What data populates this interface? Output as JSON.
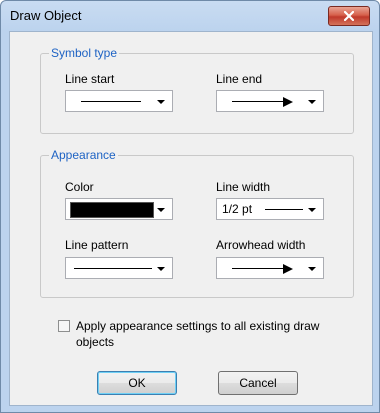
{
  "window": {
    "title": "Draw Object",
    "close_icon": "close-x-icon"
  },
  "symbol_type": {
    "legend": "Symbol type",
    "line_start_label": "Line start",
    "line_end_label": "Line end",
    "line_start_value": "plain line",
    "line_end_value": "line with arrowhead"
  },
  "appearance": {
    "legend": "Appearance",
    "color_label": "Color",
    "color_value": "#000000",
    "line_width_label": "Line width",
    "line_width_value": "1/2 pt",
    "line_pattern_label": "Line pattern",
    "line_pattern_value": "solid line",
    "arrowhead_width_label": "Arrowhead width",
    "arrowhead_width_value": "line with arrowhead"
  },
  "apply_checkbox": {
    "label": "Apply appearance settings to all existing draw objects",
    "checked": false
  },
  "buttons": {
    "ok": "OK",
    "cancel": "Cancel"
  },
  "colors": {
    "accent_legend": "#1e63c4",
    "close_button": "#c0392b"
  }
}
